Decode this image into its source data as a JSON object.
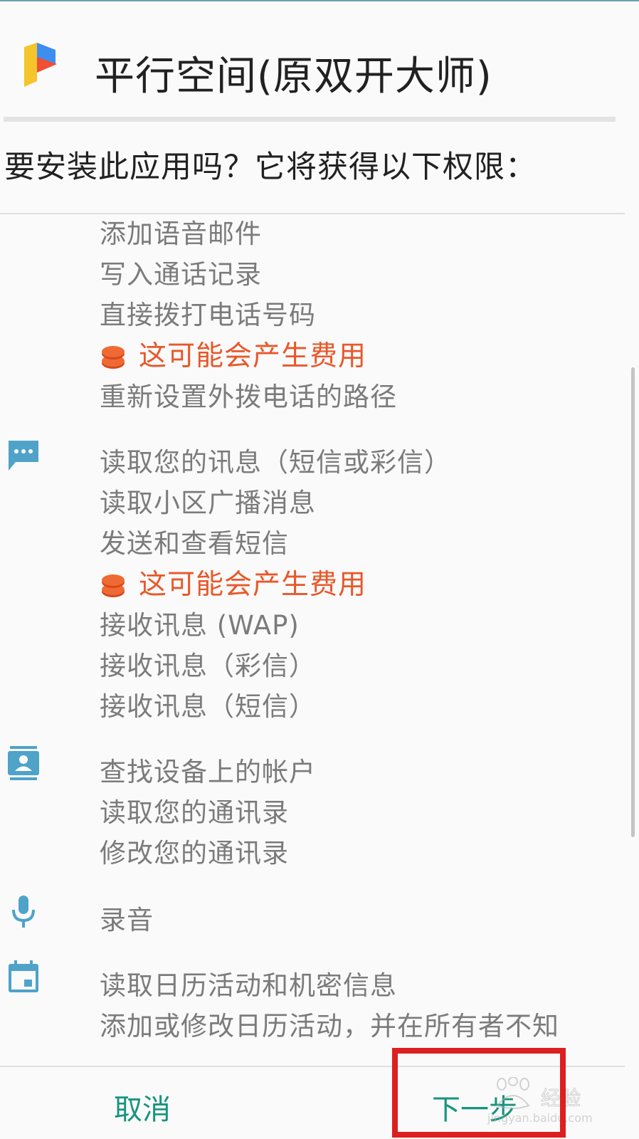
{
  "app": {
    "title": "平行空间(原双开大师)",
    "icon": "parallel-space-logo-icon"
  },
  "question": "要安装此应用吗？它将获得以下权限：",
  "phone_group": {
    "items": [
      "添加语音邮件",
      "写入通话记录",
      "直接拨打电话号码"
    ],
    "cost_warning": "这可能会产生费用",
    "after_cost": [
      "重新设置外拨电话的路径"
    ]
  },
  "sms_group": {
    "icon": "message-icon",
    "items": [
      "读取您的讯息（短信或彩信）",
      "读取小区广播消息",
      "发送和查看短信"
    ],
    "cost_warning": "这可能会产生费用",
    "after_cost": [
      "接收讯息 (WAP)",
      "接收讯息（彩信）",
      "接收讯息（短信）"
    ]
  },
  "contacts_group": {
    "icon": "contacts-icon",
    "items": [
      "查找设备上的帐户",
      "读取您的通讯录",
      "修改您的通讯录"
    ]
  },
  "mic_group": {
    "icon": "microphone-icon",
    "items": [
      "录音"
    ]
  },
  "calendar_group": {
    "icon": "calendar-icon",
    "items": [
      "读取日历活动和机密信息",
      "添加或修改日历活动，并在所有者不知"
    ]
  },
  "footer": {
    "cancel_label": "取消",
    "next_label": "下一步"
  },
  "watermark": {
    "text": "经验",
    "url": "jingyan.baidu.com"
  },
  "colors": {
    "accent": "#16947e",
    "cost_warning": "#e8582a",
    "icon": "#4fa3c9",
    "highlight": "#dd1f1f"
  }
}
